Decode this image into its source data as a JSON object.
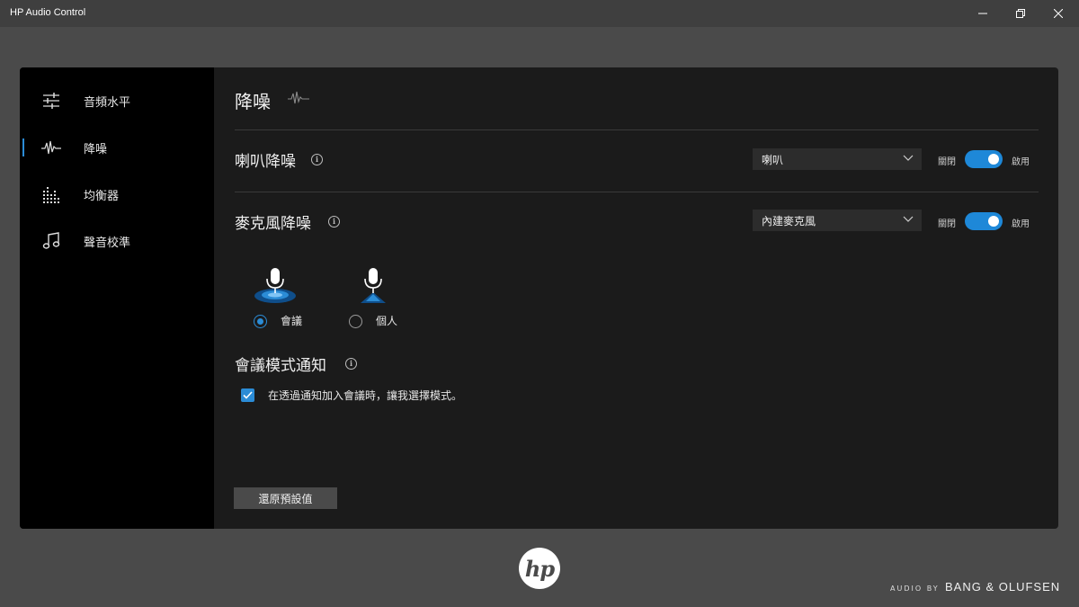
{
  "window": {
    "title": "HP Audio Control",
    "controls": {
      "minimize_icon": "minimize-icon",
      "maximize_icon": "restore-icon",
      "close_icon": "close-icon"
    }
  },
  "sidebar": {
    "items": [
      {
        "label": "音頻水平",
        "icon": "sliders-icon",
        "active": false
      },
      {
        "label": "降噪",
        "icon": "waveform-icon",
        "active": true
      },
      {
        "label": "均衡器",
        "icon": "equalizer-icon",
        "active": false
      },
      {
        "label": "聲音校準",
        "icon": "music-note-icon",
        "active": false
      }
    ],
    "accent_color": "#2b8cd6"
  },
  "main": {
    "title": "降噪",
    "speaker_section": {
      "title": "喇叭降噪",
      "dropdown_value": "喇叭",
      "toggle_off_label": "關閉",
      "toggle_on_label": "啟用",
      "enabled": true
    },
    "mic_section": {
      "title": "麥克風降噪",
      "dropdown_value": "內建麥克風",
      "toggle_off_label": "關閉",
      "toggle_on_label": "啟用",
      "enabled": true,
      "modes": [
        {
          "label": "會議",
          "selected": true,
          "icon": "conference-microphone-icon"
        },
        {
          "label": "個人",
          "selected": false,
          "icon": "personal-microphone-icon"
        }
      ]
    },
    "notification_section": {
      "title": "會議模式通知",
      "checkbox_label": "在透過通知加入會議時，讓我選擇模式。",
      "checked": true
    },
    "reset_button_label": "還原預設值"
  },
  "footer": {
    "logo_text": "hp",
    "audio_by": "AUDIO BY",
    "brand": "BANG & OLUFSEN"
  },
  "colors": {
    "accent": "#2b8cd6",
    "toggle_on": "#1e88d8",
    "background": "#4a4a4a",
    "panel": "#1b1b1b",
    "sidebar": "#000000"
  }
}
